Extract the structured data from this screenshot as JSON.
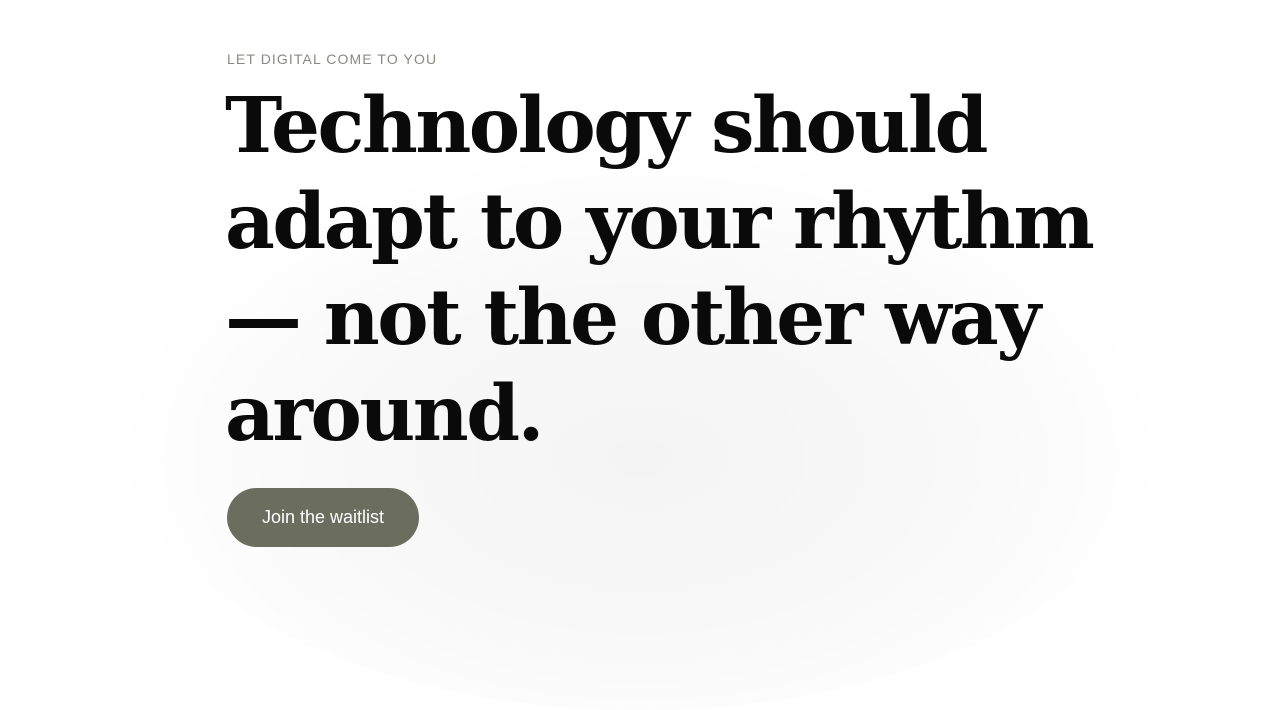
{
  "hero": {
    "eyebrow": "LET DIGITAL COME TO YOU",
    "headline": "Technology should adapt to your rhythm — not the other way around.",
    "cta_label": "Join the waitlist"
  },
  "colors": {
    "accent": "#6b6e5f",
    "eyebrow": "#8a8a83",
    "headline": "#0a0a0a",
    "background": "#ffffff"
  }
}
